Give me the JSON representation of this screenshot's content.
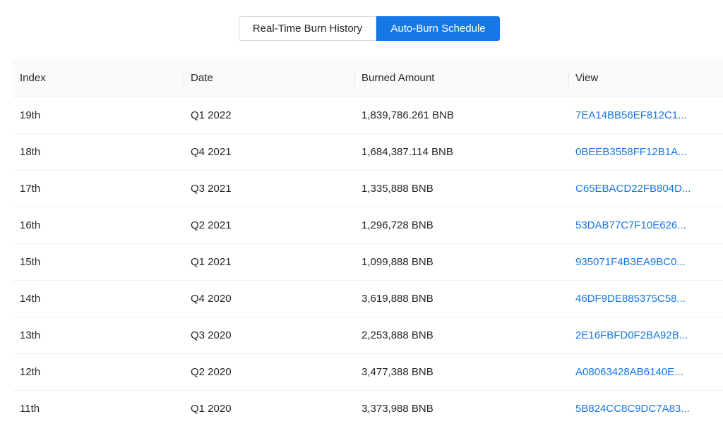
{
  "tabs": [
    {
      "label": "Real-Time Burn History",
      "active": false
    },
    {
      "label": "Auto-Burn Schedule",
      "active": true
    }
  ],
  "table": {
    "columns": [
      "Index",
      "Date",
      "Burned Amount",
      "View"
    ],
    "rows": [
      {
        "index": "19th",
        "date": "Q1 2022",
        "amount": "1,839,786.261 BNB",
        "view": "7EA14BB56EF812C1..."
      },
      {
        "index": "18th",
        "date": "Q4 2021",
        "amount": "1,684,387.114 BNB",
        "view": "0BEEB3558FF12B1A..."
      },
      {
        "index": "17th",
        "date": "Q3 2021",
        "amount": "1,335,888 BNB",
        "view": "C65EBACD22FB804D..."
      },
      {
        "index": "16th",
        "date": "Q2 2021",
        "amount": "1,296,728 BNB",
        "view": "53DAB77C7F10E626..."
      },
      {
        "index": "15th",
        "date": "Q1 2021",
        "amount": "1,099,888 BNB",
        "view": "935071F4B3EA9BC0..."
      },
      {
        "index": "14th",
        "date": "Q4 2020",
        "amount": "3,619,888 BNB",
        "view": "46DF9DE885375C58..."
      },
      {
        "index": "13th",
        "date": "Q3 2020",
        "amount": "2,253,888 BNB",
        "view": "2E16FBFD0F2BA92B..."
      },
      {
        "index": "12th",
        "date": "Q2 2020",
        "amount": "3,477,388 BNB",
        "view": "A08063428AB6140E..."
      },
      {
        "index": "11th",
        "date": "Q1 2020",
        "amount": "3,373,988 BNB",
        "view": "5B824CC8C9DC7A83..."
      }
    ]
  },
  "colors": {
    "accent": "#1677e6",
    "header_bg": "#fafafa",
    "row_border": "#f0f0f0"
  }
}
